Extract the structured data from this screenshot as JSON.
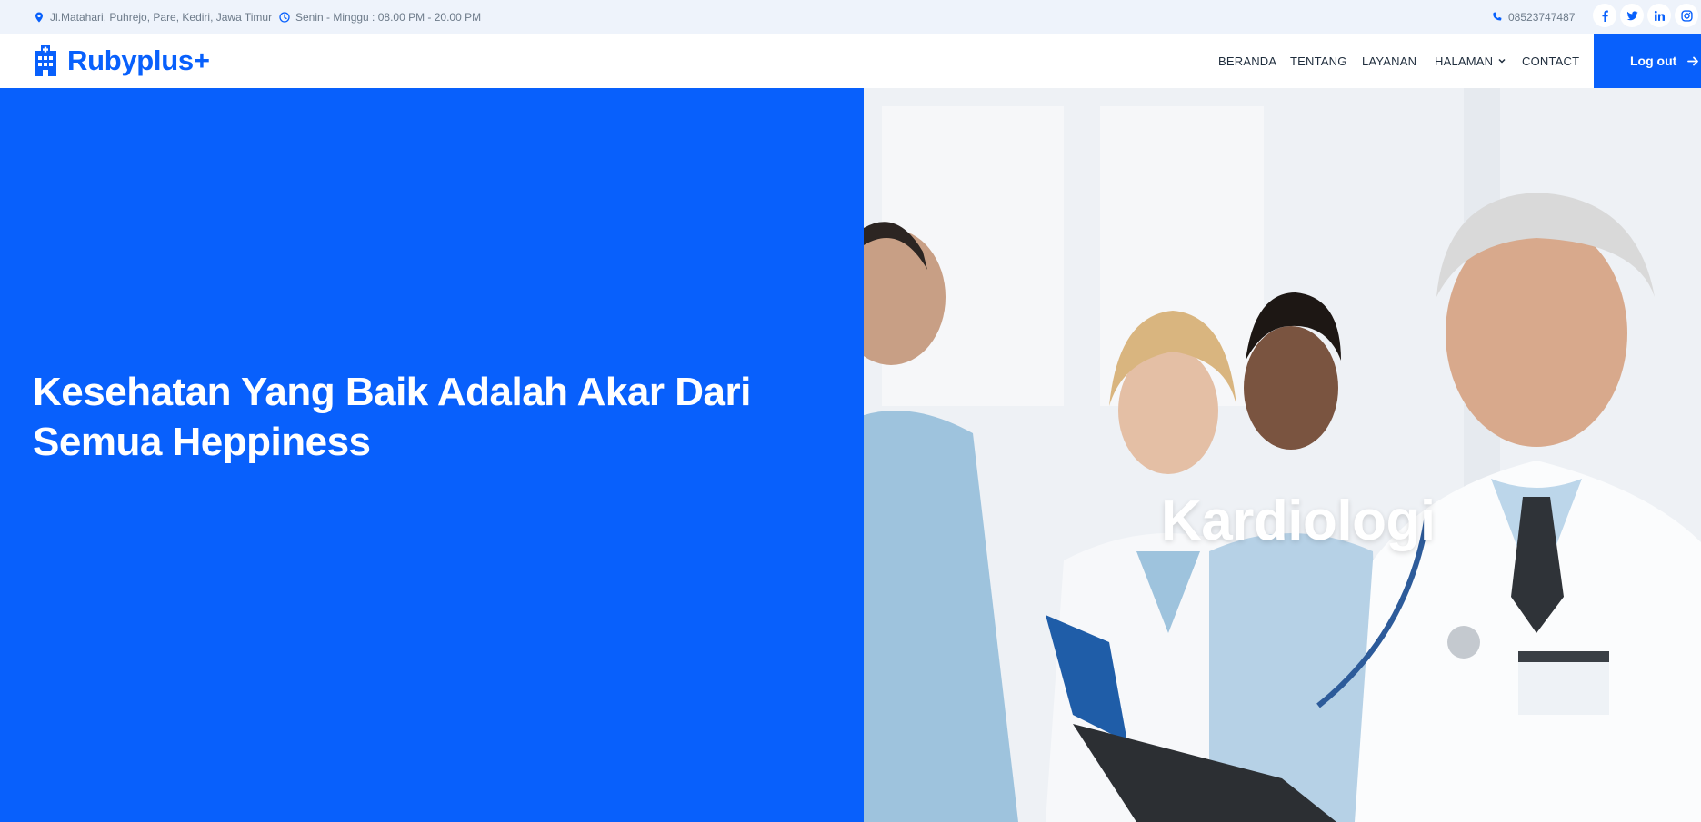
{
  "topbar": {
    "address": "Jl.Matahari, Puhrejo, Pare, Kediri, Jawa Timur",
    "hours": "Senin - Minggu : 08.00 PM - 20.00 PM",
    "phone": "08523747487",
    "socials": [
      "facebook-icon",
      "twitter-icon",
      "linkedin-icon",
      "instagram-icon"
    ]
  },
  "brand": {
    "name": "Rubyplus+",
    "icon": "hospital-building-icon"
  },
  "nav": {
    "items": [
      {
        "label": "BERANDA"
      },
      {
        "label": "TENTANG"
      },
      {
        "label": "LAYANAN"
      },
      {
        "label": "HALAMAN",
        "has_dropdown": true
      },
      {
        "label": "CONTACT"
      }
    ],
    "logout_label": "Log out"
  },
  "hero": {
    "title": "Kesehatan Yang Baik Adalah Akar Dari Semua Heppiness",
    "caption": "Kardiologi"
  },
  "colors": {
    "primary": "#0860fc",
    "topbar_bg": "#eef3fb",
    "text_dark": "#1f2d3d",
    "text_muted": "#6c7a89"
  }
}
